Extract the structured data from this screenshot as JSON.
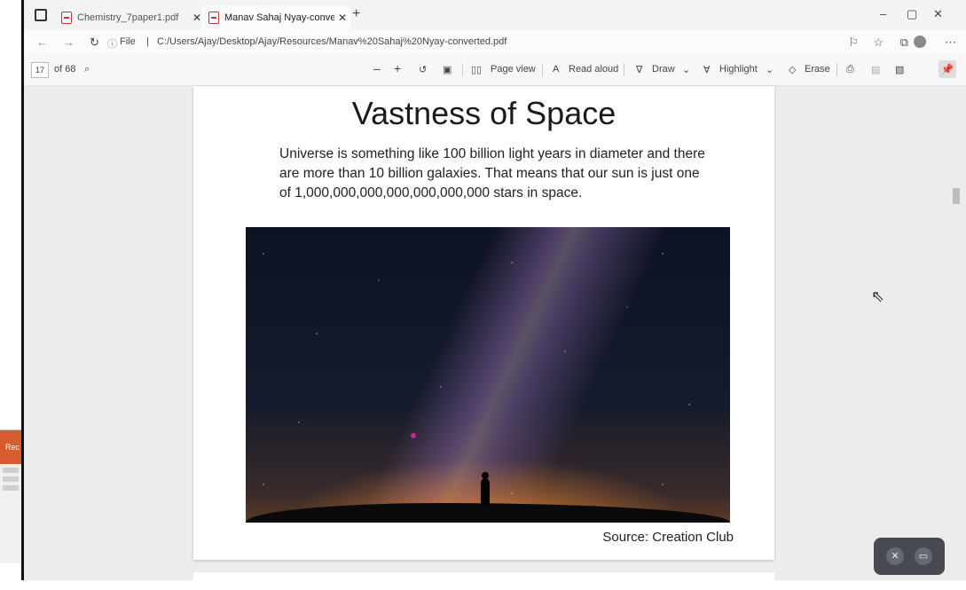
{
  "browser": {
    "tabs": [
      {
        "title": "Chemistry_7paper1.pdf"
      },
      {
        "title": "Manav Sahaj Nyay-converted.p"
      }
    ],
    "url": "C:/Users/Ajay/Desktop/Ajay/Resources/Manav%20Sahaj%20Nyay-converted.pdf",
    "url_prefix": "File"
  },
  "pdf_toolbar": {
    "page_number": "17",
    "page_total": "of 68",
    "page_view": "Page view",
    "read_aloud": "Read aloud",
    "draw": "Draw",
    "highlight": "Highlight",
    "erase": "Erase"
  },
  "page": {
    "title": "Vastness of Space",
    "body": "Universe is something like 100 billion light years in diameter and there are more than 10 billion galaxies. That means that our sun is just one of 1,000,000,000,000,000,000,000 stars in space.",
    "source": "Source: Creation Club"
  },
  "side_thumb": {
    "label": "Rec"
  }
}
